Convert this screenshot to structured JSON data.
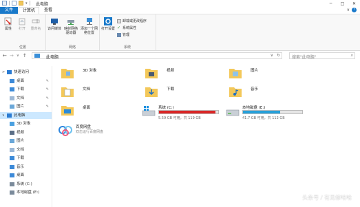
{
  "window": {
    "title": "此电脑",
    "controls": [
      "─",
      "□",
      "✕"
    ]
  },
  "tabs": {
    "file": "文件",
    "computer": "计算机",
    "view": "查看",
    "help": "?",
    "expand": "∨"
  },
  "ribbon": {
    "location_group": {
      "label": "位置",
      "buttons": [
        "属性",
        "打开",
        "重命名"
      ]
    },
    "network_group": {
      "label": "网络",
      "buttons": [
        "访问媒体",
        "映射网络驱动器",
        "添加一个网络位置"
      ]
    },
    "system_group": {
      "label": "系统",
      "open_settings": "打开设置",
      "uninstall": "卸载或更改程序",
      "system_properties": "系统属性",
      "manage": "管理"
    }
  },
  "address_bar": {
    "back": "←",
    "forward": "→",
    "dropdown": "∨",
    "up": "↑",
    "path": "此电脑",
    "search_placeholder": "搜索\"此电脑\""
  },
  "sidebar": {
    "items": [
      {
        "label": "快速访问",
        "icon": "star-icon",
        "color": "#2b7cd3",
        "level": 0,
        "pin": false,
        "expand": ">"
      },
      {
        "label": "桌面",
        "icon": "desktop-icon",
        "color": "#3c8ad8",
        "level": 1,
        "pin": true
      },
      {
        "label": "下载",
        "icon": "download-icon",
        "color": "#3c8ad8",
        "level": 1,
        "pin": true
      },
      {
        "label": "文档",
        "icon": "document-icon",
        "color": "#9cb8d6",
        "level": 1,
        "pin": true
      },
      {
        "label": "图片",
        "icon": "picture-icon",
        "color": "#6aa7d8",
        "level": 1,
        "pin": true
      },
      {
        "label": "此电脑",
        "icon": "computer-icon",
        "color": "#2b7cd3",
        "level": 0,
        "pin": false,
        "expand": "∨",
        "selected": true
      },
      {
        "label": "3D 对象",
        "icon": "cube-icon",
        "color": "#4aa0e0",
        "level": 1,
        "pin": false
      },
      {
        "label": "视频",
        "icon": "video-icon",
        "color": "#5b6e86",
        "level": 1,
        "pin": false
      },
      {
        "label": "图片",
        "icon": "picture-icon",
        "color": "#6aa7d8",
        "level": 1,
        "pin": false
      },
      {
        "label": "文档",
        "icon": "document-icon",
        "color": "#9cb8d6",
        "level": 1,
        "pin": false
      },
      {
        "label": "下载",
        "icon": "download-icon",
        "color": "#3c8ad8",
        "level": 1,
        "pin": false
      },
      {
        "label": "音乐",
        "icon": "music-icon",
        "color": "#3c8ad8",
        "level": 1,
        "pin": false
      },
      {
        "label": "桌面",
        "icon": "desktop-icon",
        "color": "#3c8ad8",
        "level": 1,
        "pin": false
      },
      {
        "label": "系统 (C:)",
        "icon": "drive-icon",
        "color": "#7a8a9a",
        "level": 1,
        "pin": false
      },
      {
        "label": "本地磁盘 (E:)",
        "icon": "drive-icon",
        "color": "#7a8a9a",
        "level": 1,
        "pin": false
      }
    ]
  },
  "folders": [
    {
      "name": "3D 对象",
      "icon": "3d-objects-folder-icon"
    },
    {
      "name": "视频",
      "icon": "videos-folder-icon"
    },
    {
      "name": "图片",
      "icon": "pictures-folder-icon"
    },
    {
      "name": "文档",
      "icon": "documents-folder-icon"
    },
    {
      "name": "下载",
      "icon": "downloads-folder-icon"
    },
    {
      "name": "音乐",
      "icon": "music-folder-icon"
    },
    {
      "name": "桌面",
      "icon": "desktop-folder-icon"
    }
  ],
  "drives": [
    {
      "name": "系统 (C:)",
      "space": "5.59 GB 可用，共 119 GB",
      "used_fraction": 0.953,
      "bar_color": "#da2626"
    },
    {
      "name": "本地磁盘 (E:)",
      "space": "41.7 GB 可用，共 112 GB",
      "used_fraction": 0.628,
      "bar_color": "#26a0da"
    }
  ],
  "other": [
    {
      "name": "百度网盘",
      "subtitle": "双击运行百度网盘",
      "icon": "baidu-netdisk-icon"
    }
  ],
  "watermark": "头条号 / 有见修哈哈"
}
